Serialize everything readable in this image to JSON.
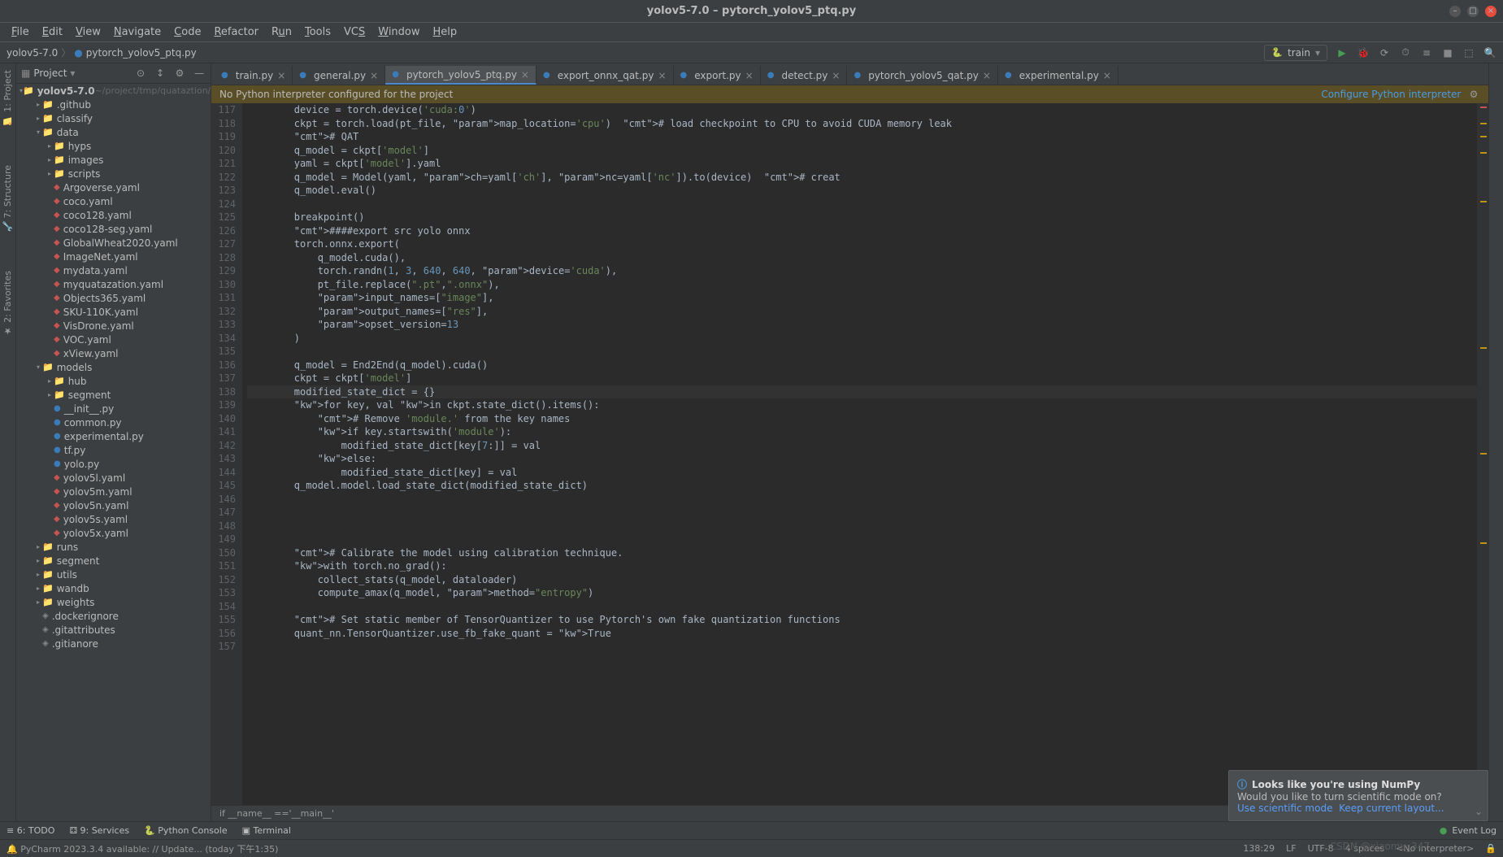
{
  "title": "yolov5-7.0 – pytorch_yolov5_ptq.py",
  "menu": {
    "file": "_F_ile",
    "edit": "_E_dit",
    "view": "_V_iew",
    "navigate": "_N_avigate",
    "code": "_C_ode",
    "refactor": "_R_efactor",
    "run": "R_u_n",
    "tools": "_T_ools",
    "vcs": "VC_S_",
    "window": "_W_indow",
    "help": "_H_elp"
  },
  "breadcrumb": {
    "root": "yolov5-7.0",
    "file": "pytorch_yolov5_ptq.py"
  },
  "runConfig": "train",
  "sidebar": {
    "title": "Project",
    "root": {
      "name": "yolov5-7.0",
      "path": "~/project/tmp/quataztion/"
    },
    "items": [
      {
        "d": 1,
        "c": "▸",
        "t": "folder",
        "n": ".github"
      },
      {
        "d": 1,
        "c": "▸",
        "t": "folder",
        "n": "classify"
      },
      {
        "d": 1,
        "c": "▾",
        "t": "folder",
        "n": "data"
      },
      {
        "d": 2,
        "c": "▸",
        "t": "folder",
        "n": "hyps"
      },
      {
        "d": 2,
        "c": "▸",
        "t": "folder",
        "n": "images"
      },
      {
        "d": 2,
        "c": "▸",
        "t": "folder",
        "n": "scripts"
      },
      {
        "d": 2,
        "c": "",
        "t": "yaml",
        "n": "Argoverse.yaml"
      },
      {
        "d": 2,
        "c": "",
        "t": "yaml",
        "n": "coco.yaml"
      },
      {
        "d": 2,
        "c": "",
        "t": "yaml",
        "n": "coco128.yaml"
      },
      {
        "d": 2,
        "c": "",
        "t": "yaml",
        "n": "coco128-seg.yaml"
      },
      {
        "d": 2,
        "c": "",
        "t": "yaml",
        "n": "GlobalWheat2020.yaml"
      },
      {
        "d": 2,
        "c": "",
        "t": "yaml",
        "n": "ImageNet.yaml"
      },
      {
        "d": 2,
        "c": "",
        "t": "yaml",
        "n": "mydata.yaml"
      },
      {
        "d": 2,
        "c": "",
        "t": "yaml",
        "n": "myquatazation.yaml"
      },
      {
        "d": 2,
        "c": "",
        "t": "yaml",
        "n": "Objects365.yaml"
      },
      {
        "d": 2,
        "c": "",
        "t": "yaml",
        "n": "SKU-110K.yaml"
      },
      {
        "d": 2,
        "c": "",
        "t": "yaml",
        "n": "VisDrone.yaml"
      },
      {
        "d": 2,
        "c": "",
        "t": "yaml",
        "n": "VOC.yaml"
      },
      {
        "d": 2,
        "c": "",
        "t": "yaml",
        "n": "xView.yaml"
      },
      {
        "d": 1,
        "c": "▾",
        "t": "folder",
        "n": "models"
      },
      {
        "d": 2,
        "c": "▸",
        "t": "folder",
        "n": "hub"
      },
      {
        "d": 2,
        "c": "▸",
        "t": "folder",
        "n": "segment"
      },
      {
        "d": 2,
        "c": "",
        "t": "py",
        "n": "__init__.py"
      },
      {
        "d": 2,
        "c": "",
        "t": "py",
        "n": "common.py"
      },
      {
        "d": 2,
        "c": "",
        "t": "py",
        "n": "experimental.py"
      },
      {
        "d": 2,
        "c": "",
        "t": "py",
        "n": "tf.py"
      },
      {
        "d": 2,
        "c": "",
        "t": "py",
        "n": "yolo.py"
      },
      {
        "d": 2,
        "c": "",
        "t": "yaml",
        "n": "yolov5l.yaml"
      },
      {
        "d": 2,
        "c": "",
        "t": "yaml",
        "n": "yolov5m.yaml"
      },
      {
        "d": 2,
        "c": "",
        "t": "yaml",
        "n": "yolov5n.yaml"
      },
      {
        "d": 2,
        "c": "",
        "t": "yaml",
        "n": "yolov5s.yaml"
      },
      {
        "d": 2,
        "c": "",
        "t": "yaml",
        "n": "yolov5x.yaml"
      },
      {
        "d": 1,
        "c": "▸",
        "t": "folder",
        "n": "runs"
      },
      {
        "d": 1,
        "c": "▸",
        "t": "folder",
        "n": "segment"
      },
      {
        "d": 1,
        "c": "▸",
        "t": "folder",
        "n": "utils"
      },
      {
        "d": 1,
        "c": "▸",
        "t": "folder",
        "n": "wandb"
      },
      {
        "d": 1,
        "c": "▸",
        "t": "folder",
        "n": "weights"
      },
      {
        "d": 1,
        "c": "",
        "t": "file",
        "n": ".dockerignore"
      },
      {
        "d": 1,
        "c": "",
        "t": "file",
        "n": ".gitattributes"
      },
      {
        "d": 1,
        "c": "",
        "t": "file",
        "n": ".gitianore"
      }
    ]
  },
  "tabs": [
    {
      "label": "train.py",
      "icon": "py"
    },
    {
      "label": "general.py",
      "icon": "py"
    },
    {
      "label": "pytorch_yolov5_ptq.py",
      "icon": "py",
      "active": true
    },
    {
      "label": "export_onnx_qat.py",
      "icon": "py"
    },
    {
      "label": "export.py",
      "icon": "py"
    },
    {
      "label": "detect.py",
      "icon": "py"
    },
    {
      "label": "pytorch_yolov5_qat.py",
      "icon": "py"
    },
    {
      "label": "experimental.py",
      "icon": "py"
    }
  ],
  "warning": {
    "msg": "No Python interpreter configured for the project",
    "link": "Configure Python interpreter"
  },
  "lineStart": 117,
  "code": [
    "        device = torch.device('cuda:0')",
    "        ckpt = torch.load(pt_file, map_location='cpu')  # load checkpoint to CPU to avoid CUDA memory leak",
    "        # QAT",
    "        q_model = ckpt['model']",
    "        yaml = ckpt['model'].yaml",
    "        q_model = Model(yaml, ch=yaml['ch'], nc=yaml['nc']).to(device)  # creat",
    "        q_model.eval()",
    "",
    "        breakpoint()",
    "        ####export src yolo onnx",
    "        torch.onnx.export(",
    "            q_model.cuda(),",
    "            torch.randn(1, 3, 640, 640, device='cuda'),",
    "            pt_file.replace(\".pt\",\".onnx\"),",
    "            input_names=[\"image\"],",
    "            output_names=[\"res\"],",
    "            opset_version=13",
    "        )",
    "",
    "        q_model = End2End(q_model).cuda()",
    "        ckpt = ckpt['model']",
    "        modified_state_dict = {}",
    "        for key, val in ckpt.state_dict().items():",
    "            # Remove 'module.' from the key names",
    "            if key.startswith('module'):",
    "                modified_state_dict[key[7:]] = val",
    "            else:",
    "                modified_state_dict[key] = val",
    "        q_model.model.load_state_dict(modified_state_dict)",
    "",
    "",
    "",
    "",
    "        # Calibrate the model using calibration technique.",
    "        with torch.no_grad():",
    "            collect_stats(q_model, dataloader)",
    "            compute_amax(q_model, method=\"entropy\")",
    "",
    "        # Set static member of TensorQuantizer to use Pytorch's own fake quantization functions",
    "        quant_nn.TensorQuantizer.use_fb_fake_quant = True",
    ""
  ],
  "crumbs": "if __name__ =='__main__'",
  "bottomTools": {
    "todo": "6: TODO",
    "services": "9: Services",
    "pyconsole": "Python Console",
    "terminal": "Terminal",
    "eventlog": "Event Log"
  },
  "statusbar": {
    "update": "PyCharm 2023.3.4 available: // Update... (today 下午1:35)",
    "pos": "138:29",
    "sep": "LF",
    "enc": "UTF-8",
    "indent": "4 spaces",
    "interp": "<No interpreter>"
  },
  "notification": {
    "title": "Looks like you're using NumPy",
    "body": "Would you like to turn scientific mode on?",
    "link1": "Use scientific mode",
    "link2": "Keep current layout..."
  },
  "watermark": "CSDN @xiaomu_347"
}
